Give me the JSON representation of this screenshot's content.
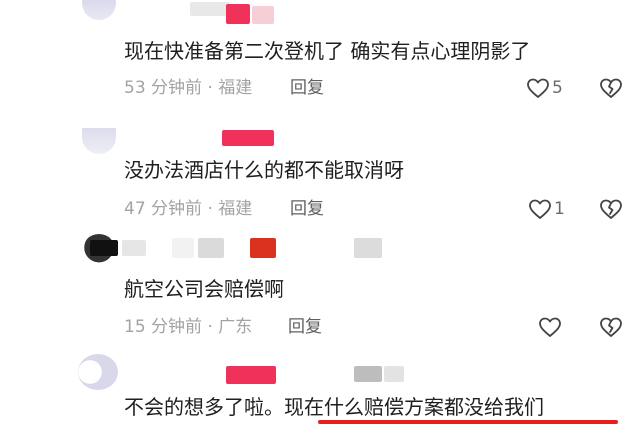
{
  "comments": [
    {
      "text": "现在快准备第二次登机了 确实有点心理阴影了",
      "time": "53 分钟前 · 福建",
      "reply_label": "回复",
      "like_count": "5"
    },
    {
      "text": "没办法酒店什么的都不能取消呀",
      "time": "47 分钟前 · 福建",
      "reply_label": "回复",
      "like_count": "1"
    },
    {
      "text": "航空公司会赔偿啊",
      "time": "15 分钟前 · 广东",
      "reply_label": "回复",
      "like_count": ""
    },
    {
      "text_before": "不会的想多了啦。",
      "text_highlight": "现在什么赔偿方案都没给我们"
    }
  ],
  "colors": {
    "highlight": "#e61e1e",
    "redacted_red": "#f0325a",
    "icon_stroke": "#444444"
  },
  "icons": [
    "heart-outline-icon",
    "broken-heart-icon"
  ]
}
